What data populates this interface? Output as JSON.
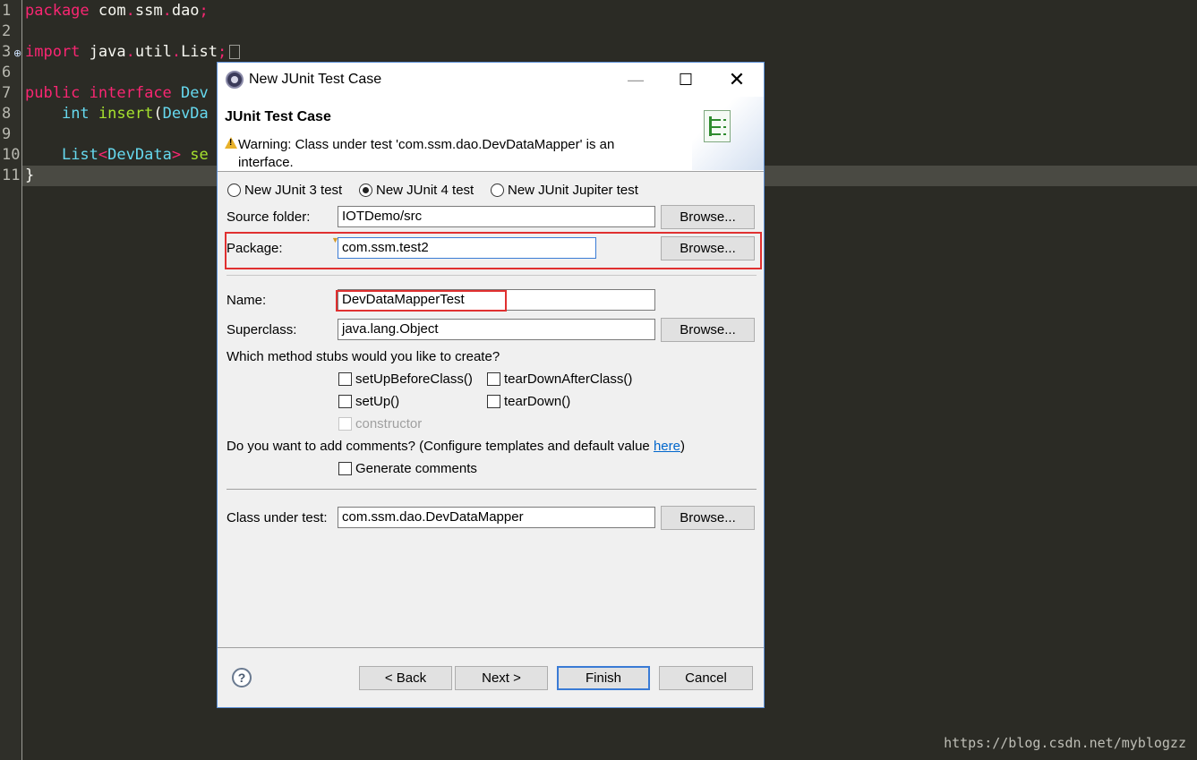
{
  "editor": {
    "line_numbers": [
      "1",
      "2",
      "3",
      "6",
      "7",
      "8",
      "9",
      "10",
      "11"
    ],
    "line1": {
      "kw": "package",
      "rest_a": " com",
      "d1": ".",
      "rest_b": "ssm",
      "d2": ".",
      "rest_c": "dao",
      "semi": ";"
    },
    "line3": {
      "kw": "import",
      "rest_a": " java",
      "d1": ".",
      "rest_b": "util",
      "d2": ".",
      "ty": "List",
      "semi": ";"
    },
    "line7": {
      "kw": "public",
      "sp": " ",
      "kw2": "interface",
      "rest": " ",
      "ty": "Dev"
    },
    "line8": {
      "indent": "    ",
      "kw": "int",
      "sp": " ",
      "fn": "insert",
      "paren": "(",
      "ty": "DevDa"
    },
    "line10": {
      "indent": "    ",
      "ty": "List",
      "lt": "<",
      "rest": "DevData",
      "gt": ">",
      "tail": " se"
    },
    "line11": {
      "brace": "}"
    },
    "watermark": "https://blog.csdn.net/myblogzz"
  },
  "dialog": {
    "title": "New JUnit Test Case",
    "window_buttons": {
      "minimize": "—",
      "maximize": "☐",
      "close": "✕"
    },
    "header_title": "JUnit Test Case",
    "warning": "Warning: Class under test 'com.ssm.dao.DevDataMapper' is an interface.",
    "radios": [
      {
        "label": "New JUnit 3 test",
        "selected": false
      },
      {
        "label": "New JUnit 4 test",
        "selected": true
      },
      {
        "label": "New JUnit Jupiter test",
        "selected": false
      }
    ],
    "source_folder": {
      "label": "Source folder:",
      "value": "IOTDemo/src",
      "browse": "Browse..."
    },
    "package": {
      "label": "Package:",
      "value": "com.ssm.test2",
      "browse": "Browse..."
    },
    "name": {
      "label": "Name:",
      "value": "DevDataMapperTest"
    },
    "superclass": {
      "label": "Superclass:",
      "value": "java.lang.Object",
      "browse": "Browse..."
    },
    "stubs_question": "Which method stubs would you like to create?",
    "stubs": {
      "setUpBeforeClass": "setUpBeforeClass()",
      "tearDownAfterClass": "tearDownAfterClass()",
      "setUp": "setUp()",
      "tearDown": "tearDown()",
      "constructor": "constructor"
    },
    "comments_question_a": "Do you want to add comments? (Configure templates and default value ",
    "comments_link": "here",
    "comments_question_b": ")",
    "generate_comments": "Generate comments",
    "class_under_test": {
      "label": "Class under test:",
      "value": "com.ssm.dao.DevDataMapper",
      "browse": "Browse..."
    },
    "help": "?",
    "buttons": {
      "back": "< Back",
      "next": "Next >",
      "finish": "Finish",
      "cancel": "Cancel"
    }
  },
  "colors": {
    "highlight_box": "#e03030",
    "focus": "#3a7bd5",
    "link": "#0066cc"
  }
}
